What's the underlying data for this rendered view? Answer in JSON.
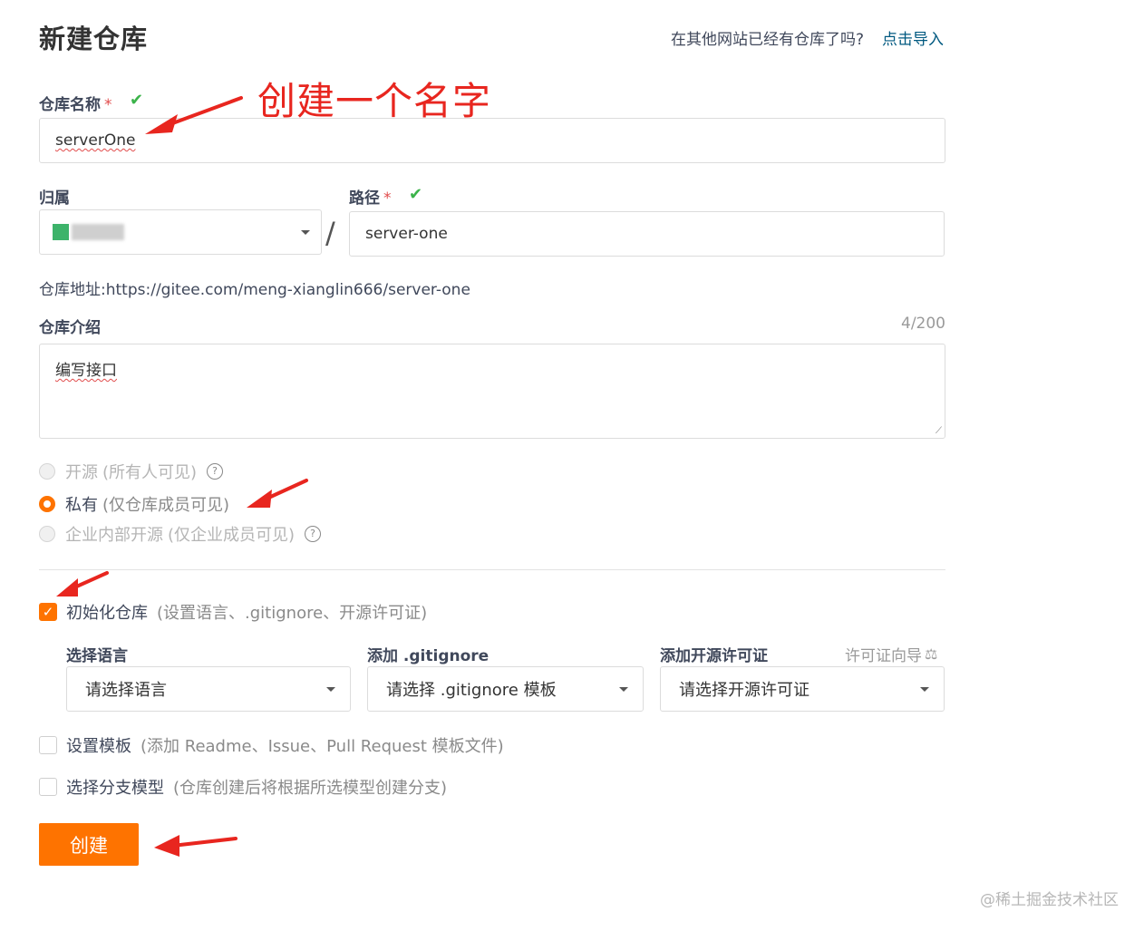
{
  "page": {
    "title": "新建仓库",
    "import_prompt": "在其他网站已经有仓库了吗?",
    "import_link": "点击导入"
  },
  "repo_name": {
    "label": "仓库名称",
    "required_mark": "*",
    "value": "serverOne"
  },
  "owner": {
    "label": "归属"
  },
  "path": {
    "label": "路径",
    "required_mark": "*",
    "separator": "/",
    "value": "server-one"
  },
  "repo_address": {
    "label": "仓库地址:",
    "url": "https://gitee.com/meng-xianglin666/server-one"
  },
  "description": {
    "label": "仓库介绍",
    "counter": "4/200",
    "value": "编写接口"
  },
  "visibility": {
    "options": [
      {
        "label": "开源",
        "hint": "(所有人可见)",
        "selected": false,
        "enabled": false,
        "help": "?"
      },
      {
        "label": "私有",
        "hint": "(仅仓库成员可见)",
        "selected": true,
        "enabled": true
      },
      {
        "label": "企业内部开源",
        "hint": "(仅企业成员可见)",
        "selected": false,
        "enabled": false,
        "help": "?"
      }
    ]
  },
  "init_repo": {
    "label": "初始化仓库",
    "hint": "(设置语言、.gitignore、开源许可证)",
    "checked": true
  },
  "language": {
    "label": "选择语言",
    "placeholder": "请选择语言"
  },
  "gitignore": {
    "label": "添加 .gitignore",
    "placeholder": "请选择 .gitignore 模板"
  },
  "license": {
    "label": "添加开源许可证",
    "guide": "许可证向导",
    "placeholder": "请选择开源许可证"
  },
  "template": {
    "label": "设置模板",
    "hint": "(添加 Readme、Issue、Pull Request 模板文件)",
    "checked": false
  },
  "branch_model": {
    "label": "选择分支模型",
    "hint": "(仓库创建后将根据所选模型创建分支)",
    "checked": false
  },
  "create_button": "创建",
  "annotation": {
    "text": "创建一个名字"
  },
  "watermark": "@稀土掘金技术社区",
  "colors": {
    "accent": "#fe7300",
    "link": "#005980",
    "success": "#3bb34a",
    "annotation": "#e8261f"
  }
}
